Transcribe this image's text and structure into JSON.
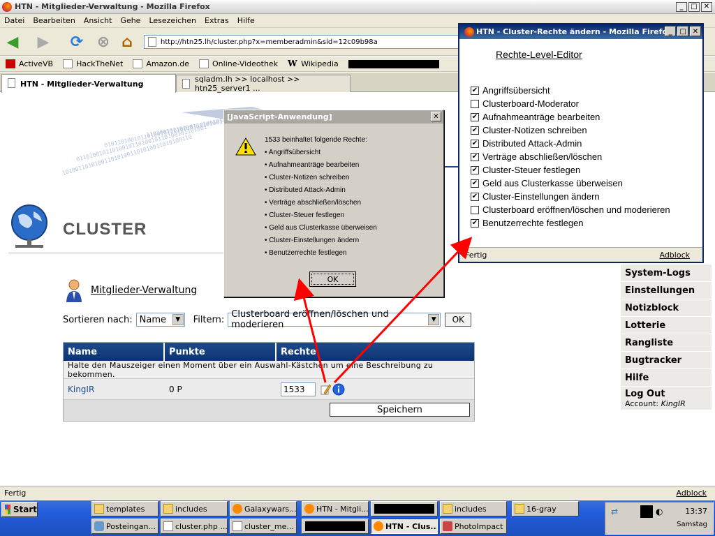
{
  "browser": {
    "title": "HTN - Mitglieder-Verwaltung - Mozilla Firefox",
    "menu": [
      "Datei",
      "Bearbeiten",
      "Ansicht",
      "Gehe",
      "Lesezeichen",
      "Extras",
      "Hilfe"
    ],
    "url": "http://htn25.lh/cluster.php?x=memberadmin&sid=12c09b98a",
    "bookmarks": [
      "ActiveVB",
      "HackTheNet",
      "Amazon.de",
      "Online-Videothek",
      "Wikipedia"
    ],
    "tabs": [
      "HTN - Mitglieder-Verwaltung",
      "sqladm.lh >> localhost >> htn25_server1 ..."
    ],
    "status": "Fertig",
    "adblock": "Adblock"
  },
  "page": {
    "heading": "CLUSTER",
    "section_title": "Mitglieder-Verwaltung",
    "sort_label": "Sortieren nach:",
    "sort_value": "Name",
    "filter_label": "Filtern:",
    "filter_value": "Clusterboard eröffnen/löschen und moderieren",
    "ok": "OK",
    "table": {
      "headers": [
        "Name",
        "Punkte",
        "Rechte"
      ],
      "hint": "Halte den Mauszeiger einen Moment über ein Auswahl-Kästchen um eine Beschreibung zu bekommen.",
      "rows": [
        {
          "name": "KingIR",
          "points": "0 P",
          "rights": "1533"
        }
      ],
      "save": "Speichern"
    },
    "side_menu": [
      "System-Logs",
      "Einstellungen",
      "Notizblock",
      "Lotterie",
      "Rangliste",
      "Bugtracker",
      "Hilfe",
      "Log Out"
    ],
    "account_label": "Account:",
    "account_name": "KingIR"
  },
  "alert": {
    "title": "[JavaScript-Anwendung]",
    "intro": "1533 beinhaltet folgende Rechte:",
    "items": [
      "Angriffsübersicht",
      "Aufnahmeanträge bearbeiten",
      "Cluster-Notizen schreiben",
      "Distributed Attack-Admin",
      "Verträge abschließen/löschen",
      "Cluster-Steuer festlegen",
      "Geld aus Clusterkasse überweisen",
      "Cluster-Einstellungen ändern",
      "Benutzerrechte festlegen"
    ],
    "ok": "OK"
  },
  "popup": {
    "title": "HTN - Cluster-Rechte ändern - Mozilla Firefox",
    "heading": "Rechte-Level-Editor",
    "items": [
      {
        "label": "Angriffsübersicht",
        "checked": true
      },
      {
        "label": "Clusterboard-Moderator",
        "checked": false
      },
      {
        "label": "Aufnahmeanträge bearbeiten",
        "checked": true
      },
      {
        "label": "Cluster-Notizen schreiben",
        "checked": true
      },
      {
        "label": "Distributed Attack-Admin",
        "checked": true
      },
      {
        "label": "Verträge abschließen/löschen",
        "checked": true
      },
      {
        "label": "Cluster-Steuer festlegen",
        "checked": true
      },
      {
        "label": "Geld aus Clusterkasse überweisen",
        "checked": true
      },
      {
        "label": "Cluster-Einstellungen ändern",
        "checked": true
      },
      {
        "label": "Clusterboard eröffnen/löschen und moderieren",
        "checked": false
      },
      {
        "label": "Benutzerrechte festlegen",
        "checked": true
      }
    ],
    "status": "Fertig",
    "adblock": "Adblock"
  },
  "taskbar": {
    "start": "Start",
    "row1": [
      "templates",
      "includes",
      "Galaxywars...",
      "HTN - Mitgli...",
      "includes",
      "16-gray"
    ],
    "row2": [
      "Posteingan...",
      "cluster.php ...",
      "cluster_me...",
      "HTN - Clus...",
      "PhotoImpact"
    ],
    "clock": "13:37",
    "day": "Samstag"
  },
  "colors": {
    "table_header": "#0d3370",
    "arrow": "#ff0000",
    "dialog_title": "#a8a8a0"
  }
}
